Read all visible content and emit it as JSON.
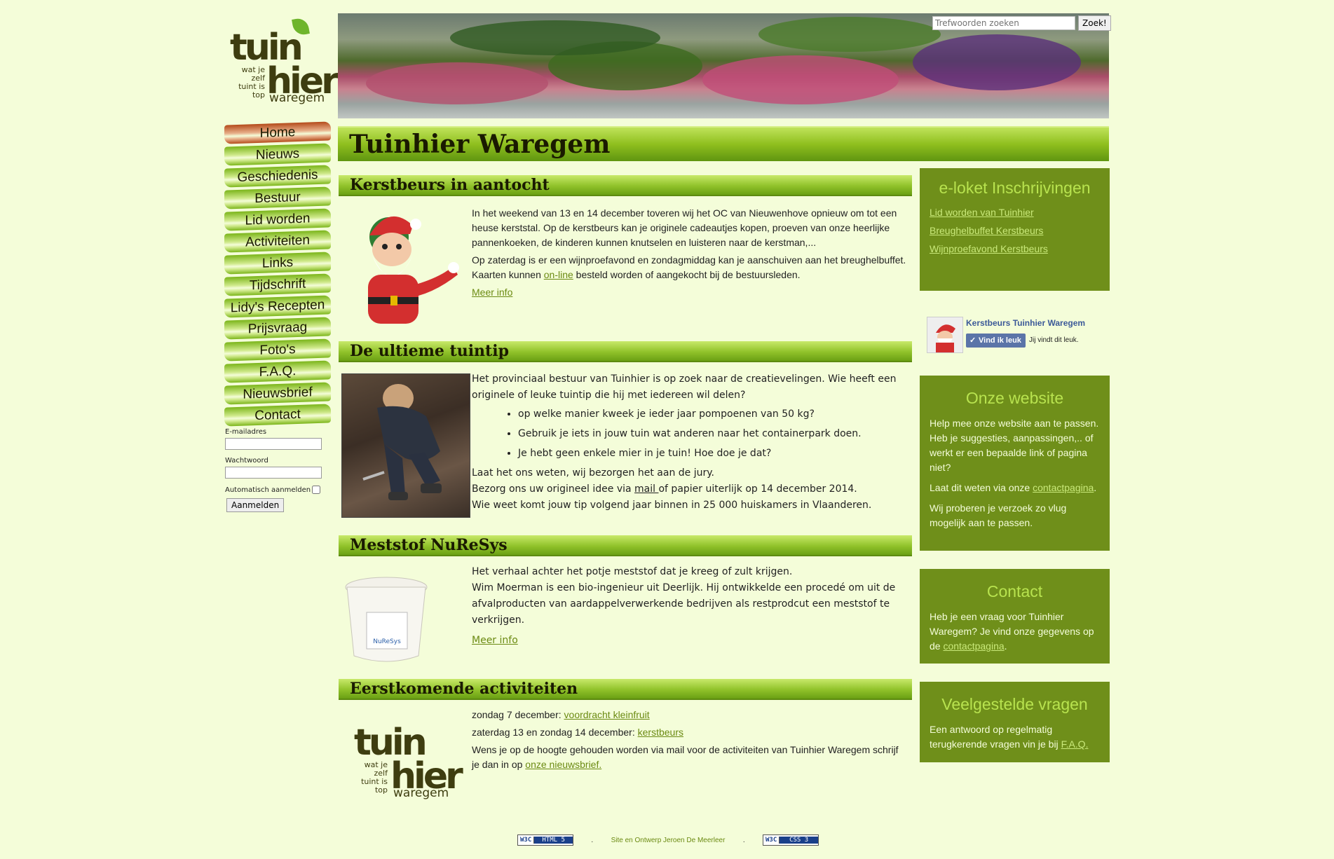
{
  "logo": {
    "brand_top": "tuin",
    "brand_bottom": "hier",
    "slogan": "wat je zelf tuint is top",
    "city": "waregem"
  },
  "search": {
    "placeholder": "Trefwoorden zoeken",
    "button": "Zoek!"
  },
  "nav": [
    {
      "label": "Home",
      "active": true
    },
    {
      "label": "Nieuws"
    },
    {
      "label": "Geschiedenis"
    },
    {
      "label": "Bestuur"
    },
    {
      "label": "Lid worden"
    },
    {
      "label": "Activiteiten"
    },
    {
      "label": "Links"
    },
    {
      "label": "Tijdschrift"
    },
    {
      "label": "Lidy's Recepten"
    },
    {
      "label": "Prijsvraag"
    },
    {
      "label": "Foto's"
    },
    {
      "label": "F.A.Q."
    },
    {
      "label": "Nieuwsbrief"
    },
    {
      "label": "Contact"
    }
  ],
  "login": {
    "email_label": "E-mailadres",
    "password_label": "Wachtwoord",
    "auto_label": "Automatisch aanmelden",
    "submit": "Aanmelden"
  },
  "page_title": "Tuinhier Waregem",
  "sections": {
    "kerst": {
      "title": "Kerstbeurs in aantocht",
      "p1": "In het weekend van 13 en 14 december toveren wij het OC van Nieuwenhove opnieuw om tot een heuse kerststal.  Op de kerstbeurs kan je originele cadeautjes kopen, proeven van onze heerlijke pannenkoeken, de kinderen kunnen knutselen en luisteren naar de kerstman,...",
      "p2_a": "Op zaterdag is er een wijnproefavond en zondagmiddag kan je aanschuiven aan het breughelbuffet.  Kaarten kunnen ",
      "p2_link": "on-line",
      "p2_b": " besteld worden of aangekocht bij de bestuursleden.",
      "more": "Meer info"
    },
    "tuintip": {
      "title": "De ultieme tuintip",
      "intro": "Het provinciaal bestuur van Tuinhier is op zoek naar de creatievelingen. Wie heeft een originele of leuke tuintip die hij met iedereen wil delen?",
      "bullets": [
        "op welke manier kweek je ieder jaar pompoenen van 50 kg?",
        "Gebruik je iets in jouw tuin wat anderen naar het containerpark doen.",
        "Je hebt geen enkele mier in je tuin! Hoe doe je dat?"
      ],
      "line1": "Laat het ons weten, wij bezorgen het aan de jury.",
      "line2_a": "Bezorg ons uw origineel idee via ",
      "line2_link": "mail ",
      "line2_b": "of papier uiterlijk op 14 december 2014.",
      "line3": "Wie weet komt jouw tip volgend jaar binnen in 25 000 huiskamers in Vlaanderen."
    },
    "meststof": {
      "title": "Meststof NuReSys",
      "p1": "Het verhaal achter het potje meststof dat je kreeg of zult krijgen.",
      "p2": "Wim Moerman is een bio-ingenieur uit Deerlijk.  Hij ontwikkelde een procedé om uit de afvalproducten van aardappelverwerkende bedrijven als restprodcut een meststof te verkrijgen.",
      "more": "Meer info",
      "bucket_label": "NuReSys"
    },
    "activiteiten": {
      "title": "Eerstkomende activiteiten",
      "a1_date": "zondag 7 december: ",
      "a1_link": "voordracht kleinfruit",
      "a2_date": "zaterdag 13 en zondag 14 december: ",
      "a2_link": "kerstbeurs",
      "p3_a": "Wens je op de hoogte gehouden worden via mail voor de activiteiten van Tuinhier Waregem schrijf je dan in op ",
      "p3_link": "onze nieuwsbrief."
    }
  },
  "sidebar": {
    "eloket": {
      "title": "e-loket Inschrijvingen",
      "links": [
        "Lid worden van Tuinhier",
        "Breughelbuffet Kerstbeurs",
        "Wijnproefavond Kerstbeurs"
      ]
    },
    "fb": {
      "page": "Kerstbeurs Tuinhier Waregem",
      "button": "Vind ik leuk",
      "text": "Jij vindt dit leuk."
    },
    "website": {
      "title": "Onze website",
      "p1": "Help mee onze website aan te passen. Heb je suggesties, aanpassingen,.. of werkt er een bepaalde link of pagina niet?",
      "p2_a": "Laat dit weten via onze ",
      "p2_link": "contactpagina",
      "p2_b": ".",
      "p3": "Wij proberen je verzoek zo vlug mogelijk aan te passen."
    },
    "contact": {
      "title": "Contact",
      "p_a": "Heb je een vraag voor Tuinhier Waregem? Je vind onze gegevens op de ",
      "p_link": "contactpagina",
      "p_b": "."
    },
    "faq": {
      "title": "Veelgestelde vragen",
      "p_a": "Een antwoord op regelmatig terugkerende vragen vin je bij ",
      "p_link": "F.A.Q.",
      "p_b": ""
    }
  },
  "footer": {
    "html_badge": "HTML 5",
    "css_badge": "CSS 3",
    "w3c": "W3C",
    "credit": "Site en Ontwerp Jeroen De Meerleer",
    "sep1": ".",
    "sep2": "."
  }
}
